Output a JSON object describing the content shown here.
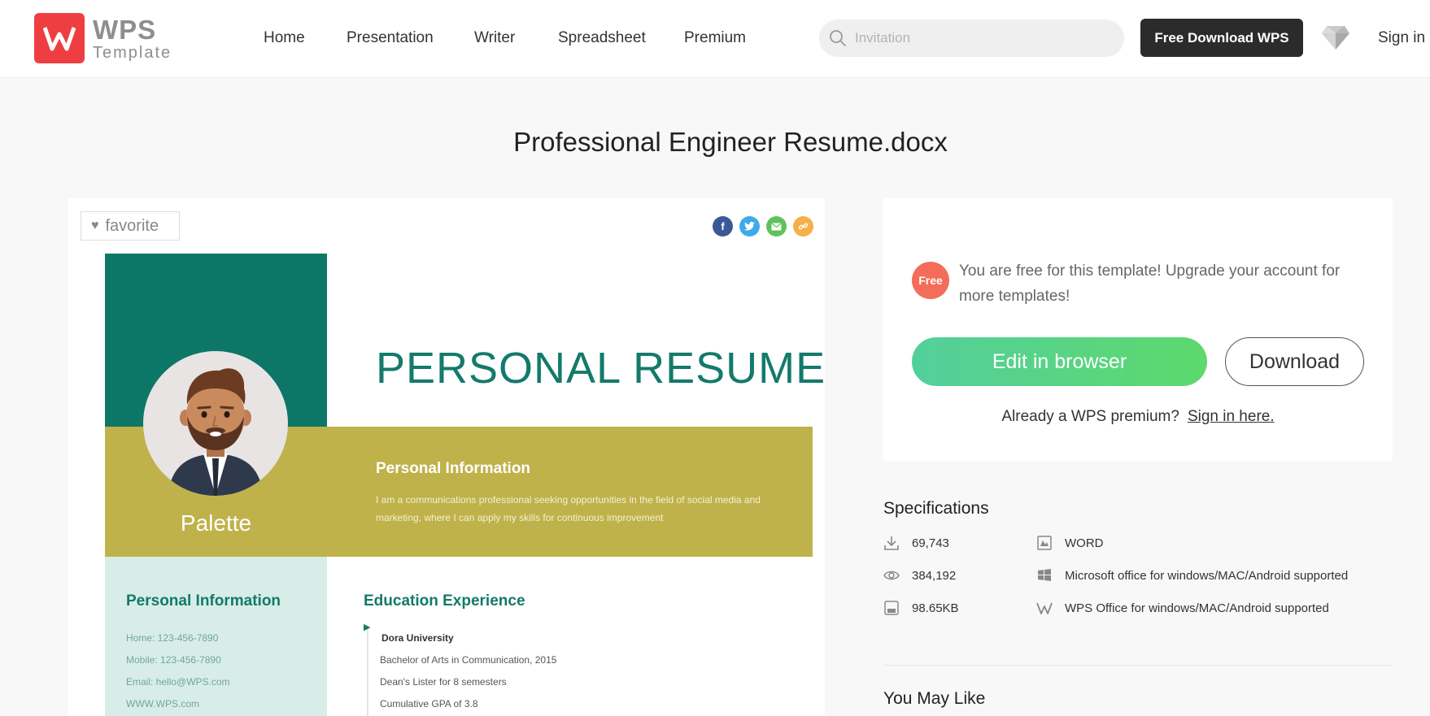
{
  "header": {
    "logo_wps": "WPS",
    "logo_template": "Template",
    "nav": [
      "Home",
      "Presentation",
      "Writer",
      "Spreadsheet",
      "Premium"
    ],
    "search_placeholder": "Invitation",
    "download_button": "Free Download WPS",
    "premium_icon": "diamond-icon",
    "sign_in": "Sign in"
  },
  "page_title": "Professional Engineer Resume.docx",
  "preview": {
    "favorite": "favorite",
    "share_icons": [
      "facebook-icon",
      "twitter-icon",
      "email-icon",
      "link-icon"
    ],
    "resume": {
      "title": "PERSONAL RESUME",
      "name": "Palette",
      "info_title": "Personal Information",
      "info_text": "I am a communications professional seeking opportunities in the field of social media and marketing, where I can apply my skills for continuous improvement",
      "side_title": "Personal Information",
      "side_lines": [
        "Home: 123-456-7890",
        "Mobile: 123-456-7890",
        "Email: hello@WPS.com",
        "WWW.WPS.com"
      ],
      "edu_title": "Education Experience",
      "edu_lines": [
        "Dora University",
        "Bachelor of Arts in Communication, 2015",
        "Dean's Lister for 8 semesters",
        "Cumulative GPA of 3.8"
      ]
    }
  },
  "panel": {
    "badge": "Free",
    "free_text": "You are free for this template! Upgrade your account for more templates!",
    "edit_button": "Edit in browser",
    "download_button": "Download",
    "premium_question": "Already a WPS premium?",
    "sign_in_link": "Sign in here."
  },
  "specifications": {
    "title": "Specifications",
    "downloads": "69,743",
    "views": "384,192",
    "size": "98.65KB",
    "format": "WORD",
    "ms_support": "Microsoft office for windows/MAC/Android supported",
    "wps_support": "WPS Office for windows/MAC/Android supported"
  },
  "you_may_like": "You May Like",
  "colors": {
    "brand_red": "#ef3e42",
    "accent_green": "#5dd96d",
    "resume_teal": "#0c7766",
    "resume_olive": "#bfb24a"
  }
}
